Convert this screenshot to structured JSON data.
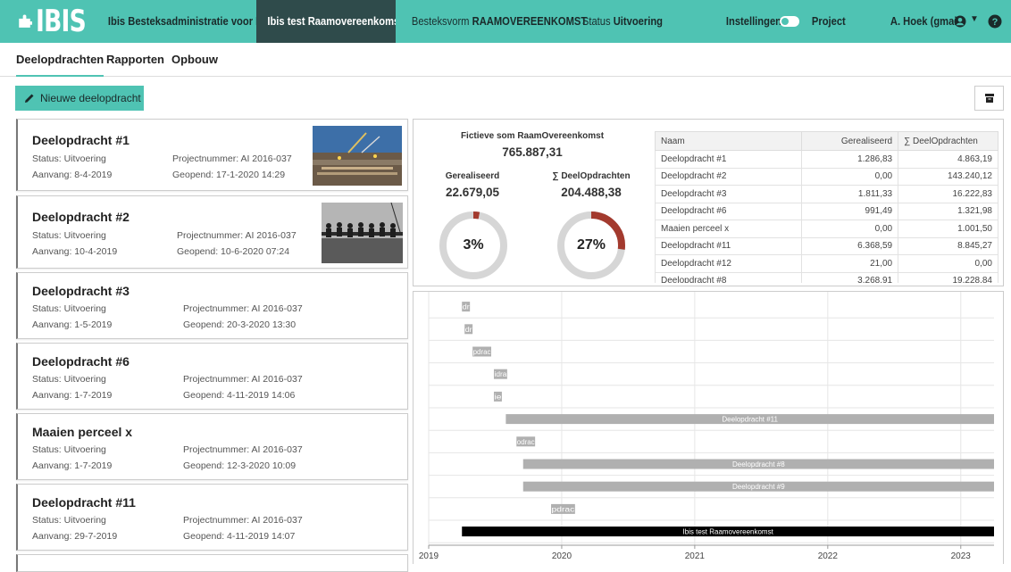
{
  "topbar": {
    "logo_text": "IBIS",
    "app_name": "Ibis Besteksadministratie voor Infra",
    "active_contract": "Ibis test Raamovereenkomst",
    "besteksvorm_label": "Besteksvorm",
    "besteksvorm_value": "RAAMOVEREENKOMST",
    "status_label": "Status",
    "status_value": "Uitvoering",
    "settings_label": "Instellingen",
    "project_label": "Project",
    "user_name": "A. Hoek (gmail)",
    "brand_color": "#4fc3b3",
    "active_color": "#2f4b4b"
  },
  "subnav": {
    "items": [
      "Deelopdrachten",
      "Rapporten",
      "Opbouw"
    ],
    "active": "Deelopdrachten"
  },
  "actions": {
    "new_label": "Nieuwe deelopdracht"
  },
  "cards": [
    {
      "title": "Deelopdracht #1",
      "status": "Status: Uitvoering",
      "projectnummer": "Projectnummer: AI 2016-037",
      "aanvang": "Aanvang: 8-4-2019",
      "geopend": "Geopend: 17-1-2020 14:29",
      "thumb": "construction-site-photo"
    },
    {
      "title": "Deelopdracht #2",
      "status": "Status: Uitvoering",
      "projectnummer": "Projectnummer: AI 2016-037",
      "aanvang": "Aanvang: 10-4-2019",
      "geopend": "Geopend: 10-6-2020 07:24",
      "thumb": "workers-on-beam-photo"
    },
    {
      "title": "Deelopdracht #3",
      "status": "Status: Uitvoering",
      "projectnummer": "Projectnummer: AI 2016-037",
      "aanvang": "Aanvang: 1-5-2019",
      "geopend": "Geopend: 20-3-2020 13:30"
    },
    {
      "title": "Deelopdracht #6",
      "status": "Status: Uitvoering",
      "projectnummer": "Projectnummer: AI 2016-037",
      "aanvang": "Aanvang: 1-7-2019",
      "geopend": "Geopend: 4-11-2019 14:06"
    },
    {
      "title": "Maaien perceel x",
      "status": "Status: Uitvoering",
      "projectnummer": "Projectnummer: AI 2016-037",
      "aanvang": "Aanvang: 1-7-2019",
      "geopend": "Geopend: 12-3-2020 10:09"
    },
    {
      "title": "Deelopdracht #11",
      "status": "Status: Uitvoering",
      "projectnummer": "Projectnummer: AI 2016-037",
      "aanvang": "Aanvang: 29-7-2019",
      "geopend": "Geopend: 4-11-2019 14:07"
    }
  ],
  "summary": {
    "fictief_label": "Fictieve som RaamOvereenkomst",
    "fictief_value": "765.887,31",
    "gerealiseerd_label": "Gerealiseerd",
    "gerealiseerd_value": "22.679,05",
    "deelopdrachten_label": "∑ DeelOpdrachten",
    "deelopdrachten_value": "204.488,38",
    "gerealiseerd_pct": 3,
    "gerealiseerd_pct_label": "3%",
    "deelopdrachten_pct": 27,
    "deelopdrachten_pct_label": "27%",
    "ring_color": "#a33a2e",
    "ring_bg": "#d6d6d6"
  },
  "table": {
    "headers": [
      "Naam",
      "Gerealiseerd",
      "∑ DeelOpdrachten"
    ],
    "rows": [
      [
        "Deelopdracht #1",
        "1.286,83",
        "4.863,19"
      ],
      [
        "Deelopdracht #2",
        "0,00",
        "143.240,12"
      ],
      [
        "Deelopdracht #3",
        "1.811,33",
        "16.222,83"
      ],
      [
        "Deelopdracht #6",
        "991,49",
        "1.321,98"
      ],
      [
        "Maaien perceel x",
        "0,00",
        "1.001,50"
      ],
      [
        "Deelopdracht #11",
        "6.368,59",
        "8.845,27"
      ],
      [
        "Deelopdracht #12",
        "21,00",
        "0,00"
      ],
      [
        "Deelopdracht #8",
        "3.268,91",
        "19.228,84"
      ]
    ]
  },
  "chart_data": {
    "type": "bar",
    "orientation": "horizontal-timeline",
    "x_ticks": [
      "2019",
      "2020",
      "2021",
      "2022",
      "2023"
    ],
    "xlim": [
      2019.0,
      2023.25
    ],
    "grid": true,
    "bars": [
      {
        "label": "Deelopdracht #1",
        "short_label": "dr",
        "start": 2019.25,
        "end": 2019.31
      },
      {
        "label": "Deelopdracht #2",
        "short_label": "dr",
        "start": 2019.27,
        "end": 2019.33
      },
      {
        "label": "Deelopdracht #3",
        "short_label": "pdrac",
        "start": 2019.33,
        "end": 2019.47
      },
      {
        "label": "Deelopdracht #6",
        "short_label": "idra",
        "start": 2019.49,
        "end": 2019.59
      },
      {
        "label": "Maaien perceel x",
        "short_label": "ie",
        "start": 2019.49,
        "end": 2019.55
      },
      {
        "label": "Deelopdracht #11",
        "short_label": "Deelopdracht #11",
        "start": 2019.58,
        "end": 2023.25
      },
      {
        "label": "Deelopdracht #12",
        "short_label": "odrac",
        "start": 2019.66,
        "end": 2019.8
      },
      {
        "label": "Deelopdracht #8",
        "short_label": "Deelopdracht #8",
        "start": 2019.71,
        "end": 2023.25
      },
      {
        "label": "Deelopdracht #9",
        "short_label": "Deelopdracht #9",
        "start": 2019.71,
        "end": 2023.25
      },
      {
        "label": "Deelopdracht",
        "short_label": "pdrac",
        "start": 2019.92,
        "end": 2020.1
      },
      {
        "label": "Ibis test Raamovereenkomst",
        "short_label": "Ibis test Raamovereenkomst",
        "start": 2019.25,
        "end": 2023.25,
        "parent": true
      }
    ],
    "bar_color": "#b0b0b0",
    "parent_color": "#000000"
  }
}
